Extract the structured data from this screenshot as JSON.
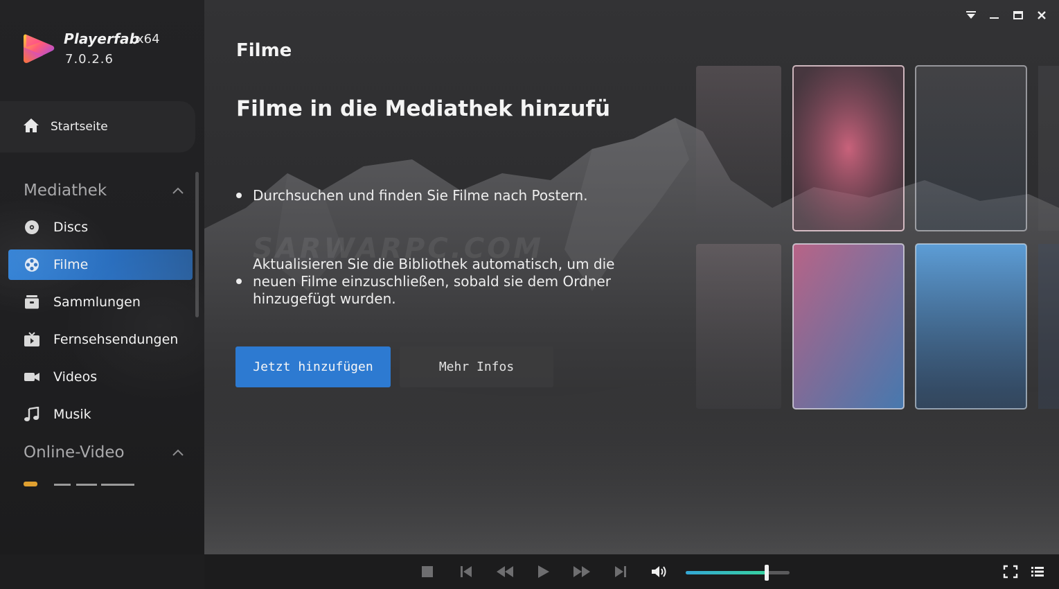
{
  "app": {
    "name": "Playerfab",
    "arch": "x64",
    "version": "7.0.2.6"
  },
  "sidebar": {
    "home_label": "Startseite",
    "sections": [
      {
        "title": "Mediathek",
        "items": [
          {
            "label": "Discs",
            "icon": "disc-icon",
            "active": false
          },
          {
            "label": "Filme",
            "icon": "film-reel-icon",
            "active": true
          },
          {
            "label": "Sammlungen",
            "icon": "collection-icon",
            "active": false
          },
          {
            "label": "Fernsehsendungen",
            "icon": "tv-icon",
            "active": false
          },
          {
            "label": "Videos",
            "icon": "video-camera-icon",
            "active": false
          },
          {
            "label": "Musik",
            "icon": "music-note-icon",
            "active": false
          }
        ]
      },
      {
        "title": "Online-Video",
        "items": []
      }
    ]
  },
  "main": {
    "page_title": "Filme",
    "headline": "Filme in die Mediathek hinzufü",
    "bullets": [
      "Durchsuchen und finden Sie Filme nach Postern.",
      "Aktualisieren Sie die Bibliothek automatisch, um die neuen Filme einzuschließen, sobald sie dem Ordner hinzugefügt wurden."
    ],
    "primary_button": "Jetzt hinzufügen",
    "secondary_button": "Mehr Infos",
    "watermark": "SARWARPC.COM"
  },
  "player": {
    "volume_fraction": 0.78
  },
  "colors": {
    "accent": "#2d7ad1",
    "sidebar_bg": "#222224",
    "volume_fill_start": "#34a7d6",
    "volume_fill_end": "#37d2a0"
  }
}
